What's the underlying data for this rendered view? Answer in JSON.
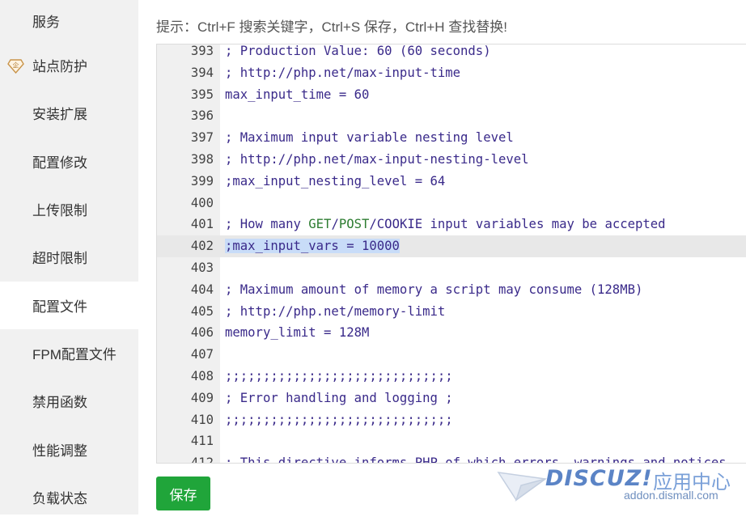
{
  "sidebar": {
    "items": [
      {
        "label": "服务",
        "top": 0
      },
      {
        "label": "站点防护",
        "icon": "diamond-badge-icon",
        "icon_text": "企"
      },
      {
        "label": "安装扩展"
      },
      {
        "label": "配置修改"
      },
      {
        "label": "上传限制"
      },
      {
        "label": "超时限制"
      },
      {
        "label": "配置文件",
        "active": true
      },
      {
        "label": "FPM配置文件"
      },
      {
        "label": "禁用函数"
      },
      {
        "label": "性能调整"
      },
      {
        "label": "负载状态"
      }
    ]
  },
  "main": {
    "tip": "提示：Ctrl+F 搜索关键字，Ctrl+S 保存，Ctrl+H 查找替换!",
    "save_label": "保存"
  },
  "editor": {
    "lines": [
      {
        "n": "393",
        "text": "; Production Value: 60 (60 seconds)"
      },
      {
        "n": "394",
        "text": "; http://php.net/max-input-time"
      },
      {
        "n": "395",
        "text": "max_input_time = 60"
      },
      {
        "n": "396",
        "text": ""
      },
      {
        "n": "397",
        "text": "; Maximum input variable nesting level"
      },
      {
        "n": "398",
        "text": "; http://php.net/max-input-nesting-level"
      },
      {
        "n": "399",
        "text": ";max_input_nesting_level = 64"
      },
      {
        "n": "400",
        "text": ""
      },
      {
        "n": "401",
        "text": "; How many GET/POST/COOKIE input variables may be accepted"
      },
      {
        "n": "402",
        "text": ";max_input_vars = 10000",
        "active": true
      },
      {
        "n": "403",
        "text": ""
      },
      {
        "n": "404",
        "text": "; Maximum amount of memory a script may consume (128MB)"
      },
      {
        "n": "405",
        "text": "; http://php.net/memory-limit"
      },
      {
        "n": "406",
        "text": "memory_limit = 128M"
      },
      {
        "n": "407",
        "text": ""
      },
      {
        "n": "408",
        "text": ";;;;;;;;;;;;;;;;;;;;;;;;;;;;;;"
      },
      {
        "n": "409",
        "text": "; Error handling and logging ;"
      },
      {
        "n": "410",
        "text": ";;;;;;;;;;;;;;;;;;;;;;;;;;;;;;"
      },
      {
        "n": "411",
        "text": ""
      },
      {
        "n": "412",
        "text": "; This directive informs PHP of which errors, warnings and notices"
      }
    ]
  },
  "watermark": {
    "brand": "DISCUZ!",
    "cn": "应用中心",
    "url": "addon.dismall.com"
  },
  "colors": {
    "accent": "#20a53a",
    "sidebar_bg": "#f1f1f1",
    "code": "#3a2a8a",
    "keyword": "#2e7d32",
    "selection": "#c8dcf8"
  }
}
